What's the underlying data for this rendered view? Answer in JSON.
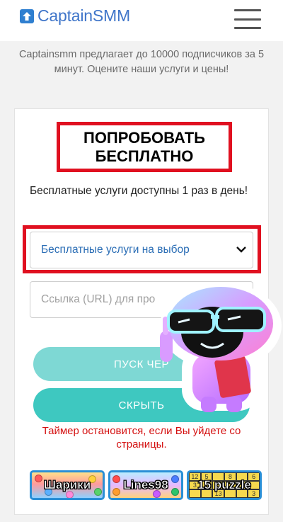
{
  "header": {
    "logo_text": "CaptainSMM",
    "menu_icon": "hamburger-icon"
  },
  "intro_text": "Captainsmm предлагает до 10000 подписчиков за 5 минут. Оцените наши услуги и цены!",
  "card": {
    "title": "ПОПРОБОВАТЬ БЕСПЛАТНО",
    "note": "Бесплатные услуги доступны 1 раз в день!",
    "service_select": {
      "selected": "Бесплатные услуги на выбор",
      "icon": "chevron-down-icon"
    },
    "url_input": {
      "placeholder": "Ссылка (URL) для про"
    },
    "start_button": "ПУСК ЧЕР",
    "hide_button": "СКРЫТЬ",
    "timer_warning": "Таймер остановится, если Вы уйдете со страницы."
  },
  "games": [
    {
      "label": "Шарики"
    },
    {
      "label": "Lines98"
    },
    {
      "label": "15 puzzle"
    }
  ],
  "puzzle_numbers": [
    "12",
    "5",
    "",
    "8",
    "",
    "6",
    "3",
    "1",
    "",
    "",
    "",
    "",
    "",
    "",
    "13",
    "",
    "",
    "3"
  ],
  "colors": {
    "accent_red": "#e01020",
    "button_teal": "#3ec8c0",
    "button_teal_light": "#7ed8d4",
    "logo_blue": "#3f75c9",
    "link_blue": "#2a6db5"
  }
}
